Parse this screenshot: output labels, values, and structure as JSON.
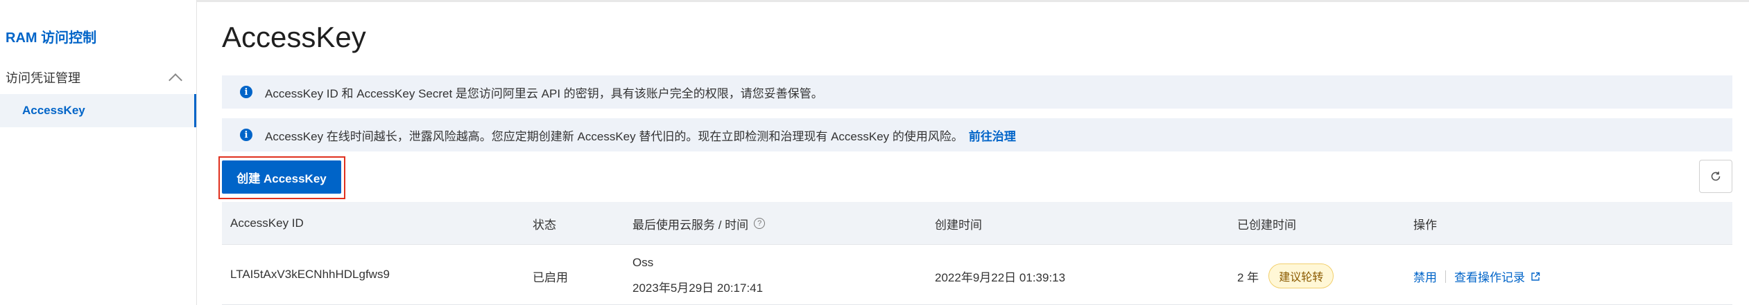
{
  "sidebar": {
    "title": "RAM 访问控制",
    "group_label": "访问凭证管理",
    "items": [
      {
        "label": "AccessKey"
      }
    ]
  },
  "page": {
    "title": "AccessKey"
  },
  "alerts": [
    {
      "text": "AccessKey ID 和 AccessKey Secret 是您访问阿里云 API 的密钥，具有该账户完全的权限，请您妥善保管。"
    },
    {
      "text": "AccessKey 在线时间越长，泄露风险越高。您应定期创建新 AccessKey 替代旧的。现在立即检测和治理现有 AccessKey 的使用风险。",
      "link": "前往治理"
    }
  ],
  "toolbar": {
    "create_label": "创建 AccessKey"
  },
  "table": {
    "columns": [
      "AccessKey ID",
      "状态",
      "最后使用云服务 / 时间",
      "创建时间",
      "已创建时间",
      "操作"
    ],
    "rows": [
      {
        "id": "LTAI5tAxV3kECNhhHDLgfws9",
        "status": "已启用",
        "last_service": "Oss",
        "last_time": "2023年5月29日 20:17:41",
        "created": "2022年9月22日 01:39:13",
        "age": "2 年",
        "badge": "建议轮转",
        "action_disable": "禁用",
        "action_log": "查看操作记录"
      }
    ]
  },
  "colors": {
    "accent": "#0064c8",
    "highlight_frame": "#e0301e",
    "badge_bg": "#fff7d6"
  }
}
